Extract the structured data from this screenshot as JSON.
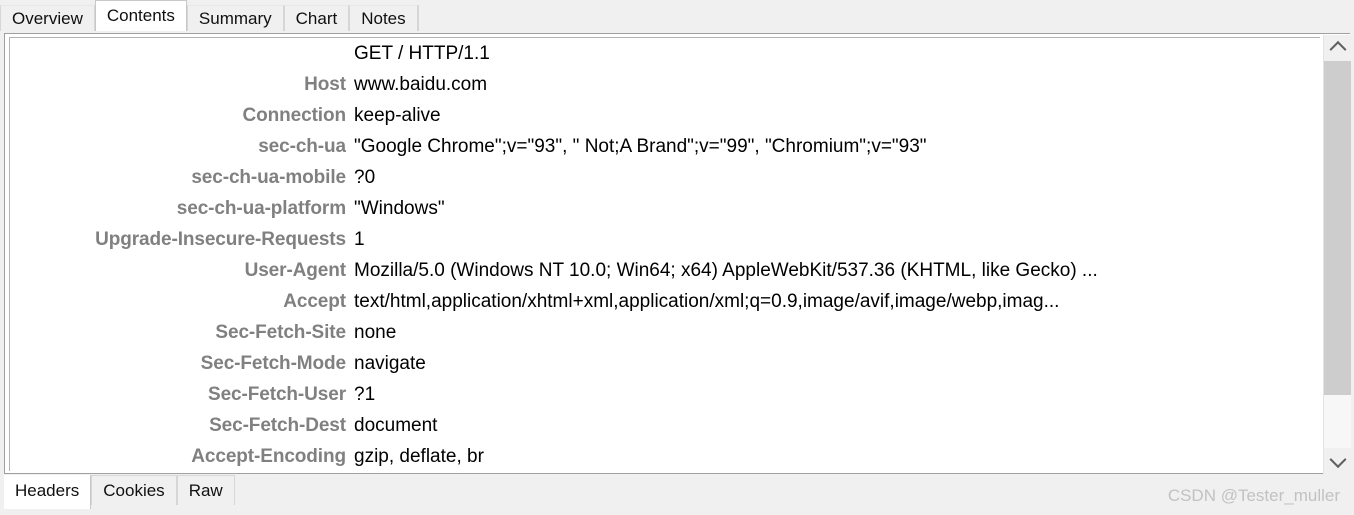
{
  "top_tabs": [
    {
      "label": "Overview",
      "active": false
    },
    {
      "label": "Contents",
      "active": true
    },
    {
      "label": "Summary",
      "active": false
    },
    {
      "label": "Chart",
      "active": false
    },
    {
      "label": "Notes",
      "active": false
    }
  ],
  "bottom_tabs": [
    {
      "label": "Headers",
      "active": true
    },
    {
      "label": "Cookies",
      "active": false
    },
    {
      "label": "Raw",
      "active": false
    }
  ],
  "headers": [
    {
      "name": "",
      "value": "GET / HTTP/1.1"
    },
    {
      "name": "Host",
      "value": "www.baidu.com"
    },
    {
      "name": "Connection",
      "value": "keep-alive"
    },
    {
      "name": "sec-ch-ua",
      "value": "\"Google Chrome\";v=\"93\", \" Not;A Brand\";v=\"99\", \"Chromium\";v=\"93\""
    },
    {
      "name": "sec-ch-ua-mobile",
      "value": "?0"
    },
    {
      "name": "sec-ch-ua-platform",
      "value": "\"Windows\""
    },
    {
      "name": "Upgrade-Insecure-Requests",
      "value": "1"
    },
    {
      "name": "User-Agent",
      "value": "Mozilla/5.0 (Windows NT 10.0; Win64; x64) AppleWebKit/537.36 (KHTML, like Gecko) ..."
    },
    {
      "name": "Accept",
      "value": "text/html,application/xhtml+xml,application/xml;q=0.9,image/avif,image/webp,imag..."
    },
    {
      "name": "Sec-Fetch-Site",
      "value": "none"
    },
    {
      "name": "Sec-Fetch-Mode",
      "value": "navigate"
    },
    {
      "name": "Sec-Fetch-User",
      "value": "?1"
    },
    {
      "name": "Sec-Fetch-Dest",
      "value": "document"
    },
    {
      "name": "Accept-Encoding",
      "value": "gzip, deflate, br"
    }
  ],
  "scrollbar": {
    "up_arrow": "chevron-up-icon",
    "down_arrow": "chevron-down-icon"
  },
  "watermark": "CSDN @Tester_muller",
  "colors": {
    "header_name": "#808080",
    "header_value": "#000000",
    "panel_bg": "#f0f0f0",
    "content_bg": "#ffffff",
    "scroll_thumb": "#cdcdcd",
    "watermark": "#c2c2c2"
  }
}
